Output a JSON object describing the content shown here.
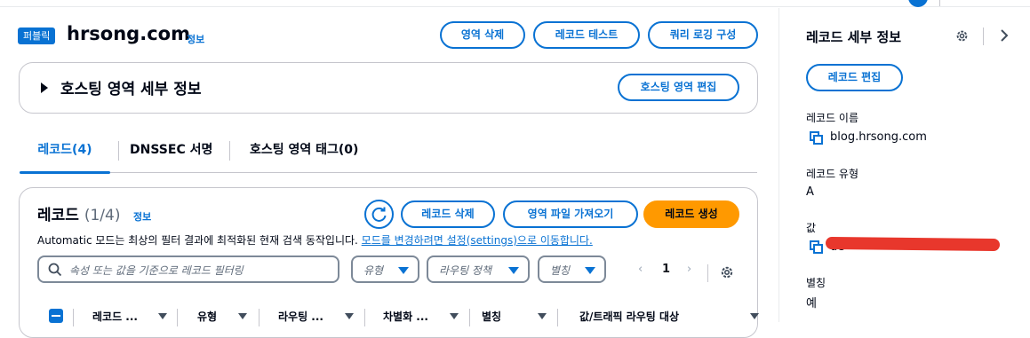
{
  "header": {
    "badge": "퍼블릭",
    "title": "hrsong.com",
    "info": "정보",
    "buttons": {
      "delete_zone": "영역 삭제",
      "test_record": "레코드 테스트",
      "query_logging": "쿼리 로깅 구성"
    }
  },
  "hosted_zone": {
    "title": "호스팅 영역 세부 정보",
    "edit_button": "호스팅 영역 편집"
  },
  "tabs": [
    {
      "label": "레코드(4)",
      "active": true
    },
    {
      "label": "DNSSEC 서명"
    },
    {
      "label": "호스팅 영역 태그(0)"
    }
  ],
  "records": {
    "title": "레코드",
    "count": "(1/4)",
    "info": "정보",
    "delete_button": "레코드 삭제",
    "import_button": "영역 파일 가져오기",
    "create_button": "레코드 생성",
    "description": "Automatic 모드는 최상의 필터 결과에 최적화된 현재 검색 동작입니다.",
    "description_link": "모드를 변경하려면 설정(settings)으로 이동합니다.",
    "search_placeholder": "속성 또는 값을 기준으로 레코드 필터링",
    "filter_type": "유형",
    "filter_routing": "라우팅 정책",
    "filter_alias": "별칭",
    "page": "1",
    "columns": [
      "레코드 ...",
      "유형",
      "라우팅 ...",
      "차별화 ...",
      "별칭",
      "값/트래픽 라우팅 대상"
    ]
  },
  "details": {
    "title": "레코드 세부 정보",
    "edit_button": "레코드 편집",
    "name_label": "레코드 이름",
    "name_value": "blog.hrsong.com",
    "type_label": "레코드 유형",
    "type_value": "A",
    "value_label": "값",
    "value_visible": "de",
    "alias_label": "별칭",
    "alias_value": "예"
  },
  "colors": {
    "accent": "#0972d3",
    "primary": "#ff9900",
    "redaction": "#e8372c"
  }
}
